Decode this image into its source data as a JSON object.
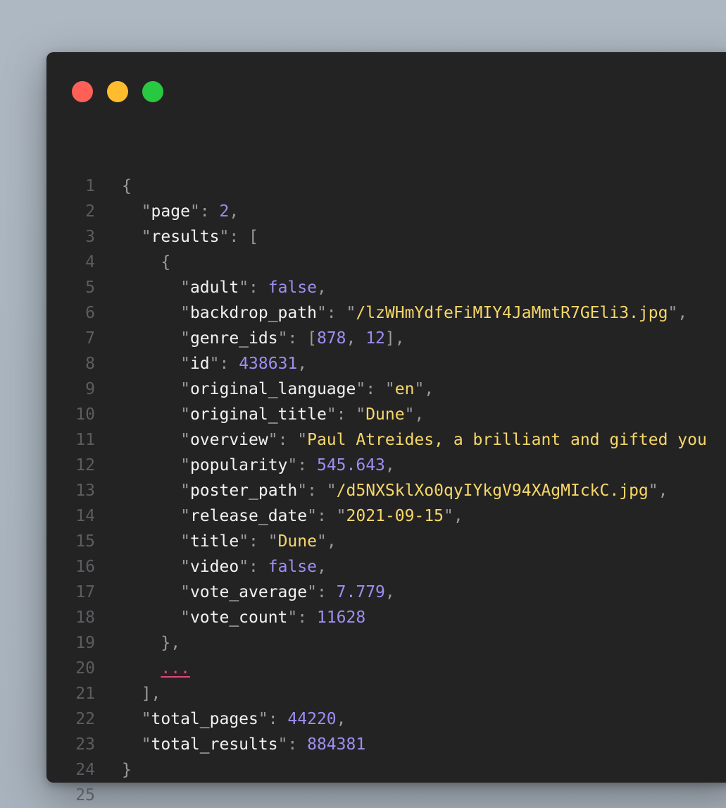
{
  "window": {
    "traffic_lights": {
      "close": "#fe5f57",
      "minimize": "#febc2e",
      "zoom": "#28c840"
    }
  },
  "colors": {
    "background": "#232324",
    "key": "#f2f2f2",
    "string": "#f6d768",
    "number": "#9d8ff0",
    "punctuation": "#9a9a9c",
    "line_number": "#5d5d60",
    "ellipsis": "#e0467a"
  },
  "editor": {
    "line_numbers": [
      "1",
      "2",
      "3",
      "4",
      "5",
      "6",
      "7",
      "8",
      "9",
      "10",
      "11",
      "12",
      "13",
      "14",
      "15",
      "16",
      "17",
      "18",
      "19",
      "20",
      "21",
      "22",
      "23",
      "24",
      "25"
    ],
    "lines": [
      [
        {
          "t": "p",
          "v": "{"
        }
      ],
      [
        {
          "t": "p",
          "v": "  \""
        },
        {
          "t": "k",
          "v": "page"
        },
        {
          "t": "p",
          "v": "\": "
        },
        {
          "t": "n",
          "v": "2"
        },
        {
          "t": "p",
          "v": ","
        }
      ],
      [
        {
          "t": "p",
          "v": "  \""
        },
        {
          "t": "k",
          "v": "results"
        },
        {
          "t": "p",
          "v": "\": ["
        }
      ],
      [
        {
          "t": "p",
          "v": "    {"
        }
      ],
      [
        {
          "t": "p",
          "v": "      \""
        },
        {
          "t": "k",
          "v": "adult"
        },
        {
          "t": "p",
          "v": "\": "
        },
        {
          "t": "b",
          "v": "false"
        },
        {
          "t": "p",
          "v": ","
        }
      ],
      [
        {
          "t": "p",
          "v": "      \""
        },
        {
          "t": "k",
          "v": "backdrop_path"
        },
        {
          "t": "p",
          "v": "\": \""
        },
        {
          "t": "s",
          "v": "/lzWHmYdfeFiMIY4JaMmtR7GEli3.jpg"
        },
        {
          "t": "p",
          "v": "\","
        }
      ],
      [
        {
          "t": "p",
          "v": "      \""
        },
        {
          "t": "k",
          "v": "genre_ids"
        },
        {
          "t": "p",
          "v": "\": ["
        },
        {
          "t": "n",
          "v": "878"
        },
        {
          "t": "p",
          "v": ", "
        },
        {
          "t": "n",
          "v": "12"
        },
        {
          "t": "p",
          "v": "],"
        }
      ],
      [
        {
          "t": "p",
          "v": "      \""
        },
        {
          "t": "k",
          "v": "id"
        },
        {
          "t": "p",
          "v": "\": "
        },
        {
          "t": "n",
          "v": "438631"
        },
        {
          "t": "p",
          "v": ","
        }
      ],
      [
        {
          "t": "p",
          "v": "      \""
        },
        {
          "t": "k",
          "v": "original_language"
        },
        {
          "t": "p",
          "v": "\": \""
        },
        {
          "t": "s",
          "v": "en"
        },
        {
          "t": "p",
          "v": "\","
        }
      ],
      [
        {
          "t": "p",
          "v": "      \""
        },
        {
          "t": "k",
          "v": "original_title"
        },
        {
          "t": "p",
          "v": "\": \""
        },
        {
          "t": "s",
          "v": "Dune"
        },
        {
          "t": "p",
          "v": "\","
        }
      ],
      [
        {
          "t": "p",
          "v": "      \""
        },
        {
          "t": "k",
          "v": "overview"
        },
        {
          "t": "p",
          "v": "\": \""
        },
        {
          "t": "s",
          "v": "Paul Atreides, a brilliant and gifted you"
        }
      ],
      [
        {
          "t": "p",
          "v": "      \""
        },
        {
          "t": "k",
          "v": "popularity"
        },
        {
          "t": "p",
          "v": "\": "
        },
        {
          "t": "n",
          "v": "545.643"
        },
        {
          "t": "p",
          "v": ","
        }
      ],
      [
        {
          "t": "p",
          "v": "      \""
        },
        {
          "t": "k",
          "v": "poster_path"
        },
        {
          "t": "p",
          "v": "\": \""
        },
        {
          "t": "s",
          "v": "/d5NXSklXo0qyIYkgV94XAgMIckC.jpg"
        },
        {
          "t": "p",
          "v": "\","
        }
      ],
      [
        {
          "t": "p",
          "v": "      \""
        },
        {
          "t": "k",
          "v": "release_date"
        },
        {
          "t": "p",
          "v": "\": \""
        },
        {
          "t": "s",
          "v": "2021-09-15"
        },
        {
          "t": "p",
          "v": "\","
        }
      ],
      [
        {
          "t": "p",
          "v": "      \""
        },
        {
          "t": "k",
          "v": "title"
        },
        {
          "t": "p",
          "v": "\": \""
        },
        {
          "t": "s",
          "v": "Dune"
        },
        {
          "t": "p",
          "v": "\","
        }
      ],
      [
        {
          "t": "p",
          "v": "      \""
        },
        {
          "t": "k",
          "v": "video"
        },
        {
          "t": "p",
          "v": "\": "
        },
        {
          "t": "b",
          "v": "false"
        },
        {
          "t": "p",
          "v": ","
        }
      ],
      [
        {
          "t": "p",
          "v": "      \""
        },
        {
          "t": "k",
          "v": "vote_average"
        },
        {
          "t": "p",
          "v": "\": "
        },
        {
          "t": "n",
          "v": "7.779"
        },
        {
          "t": "p",
          "v": ","
        }
      ],
      [
        {
          "t": "p",
          "v": "      \""
        },
        {
          "t": "k",
          "v": "vote_count"
        },
        {
          "t": "p",
          "v": "\": "
        },
        {
          "t": "n",
          "v": "11628"
        }
      ],
      [
        {
          "t": "p",
          "v": "    },"
        }
      ],
      [
        {
          "t": "p",
          "v": "    "
        },
        {
          "t": "e",
          "v": "..."
        }
      ],
      [
        {
          "t": "p",
          "v": "  ],"
        }
      ],
      [
        {
          "t": "p",
          "v": "  \""
        },
        {
          "t": "k",
          "v": "total_pages"
        },
        {
          "t": "p",
          "v": "\": "
        },
        {
          "t": "n",
          "v": "44220"
        },
        {
          "t": "p",
          "v": ","
        }
      ],
      [
        {
          "t": "p",
          "v": "  \""
        },
        {
          "t": "k",
          "v": "total_results"
        },
        {
          "t": "p",
          "v": "\": "
        },
        {
          "t": "n",
          "v": "884381"
        }
      ],
      [
        {
          "t": "p",
          "v": "}"
        }
      ],
      []
    ]
  }
}
